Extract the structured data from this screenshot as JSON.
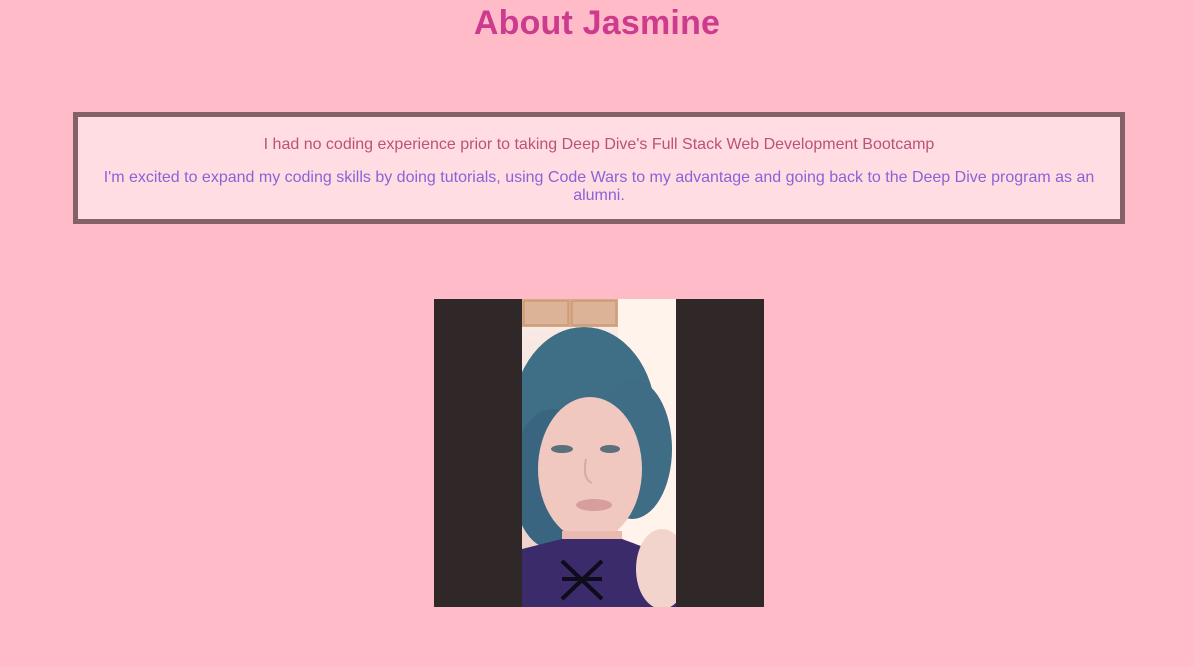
{
  "page": {
    "title": "About Jasmine"
  },
  "about": {
    "line1": "I had no coding experience prior to taking Deep Dive's Full Stack Web Development Bootcamp",
    "line2": "I'm excited to expand my coding skills by doing tutorials, using Code Wars to my advantage and going back to the Deep Dive program as an alumni."
  },
  "colors": {
    "background": "#ffbbc8",
    "title": "#cc3b8e",
    "box_border": "#866067",
    "box_background": "#ffdde3",
    "line1_text": "#bb5277",
    "line2_text": "#8a63d6"
  },
  "photo": {
    "subject": "portrait-photo"
  }
}
